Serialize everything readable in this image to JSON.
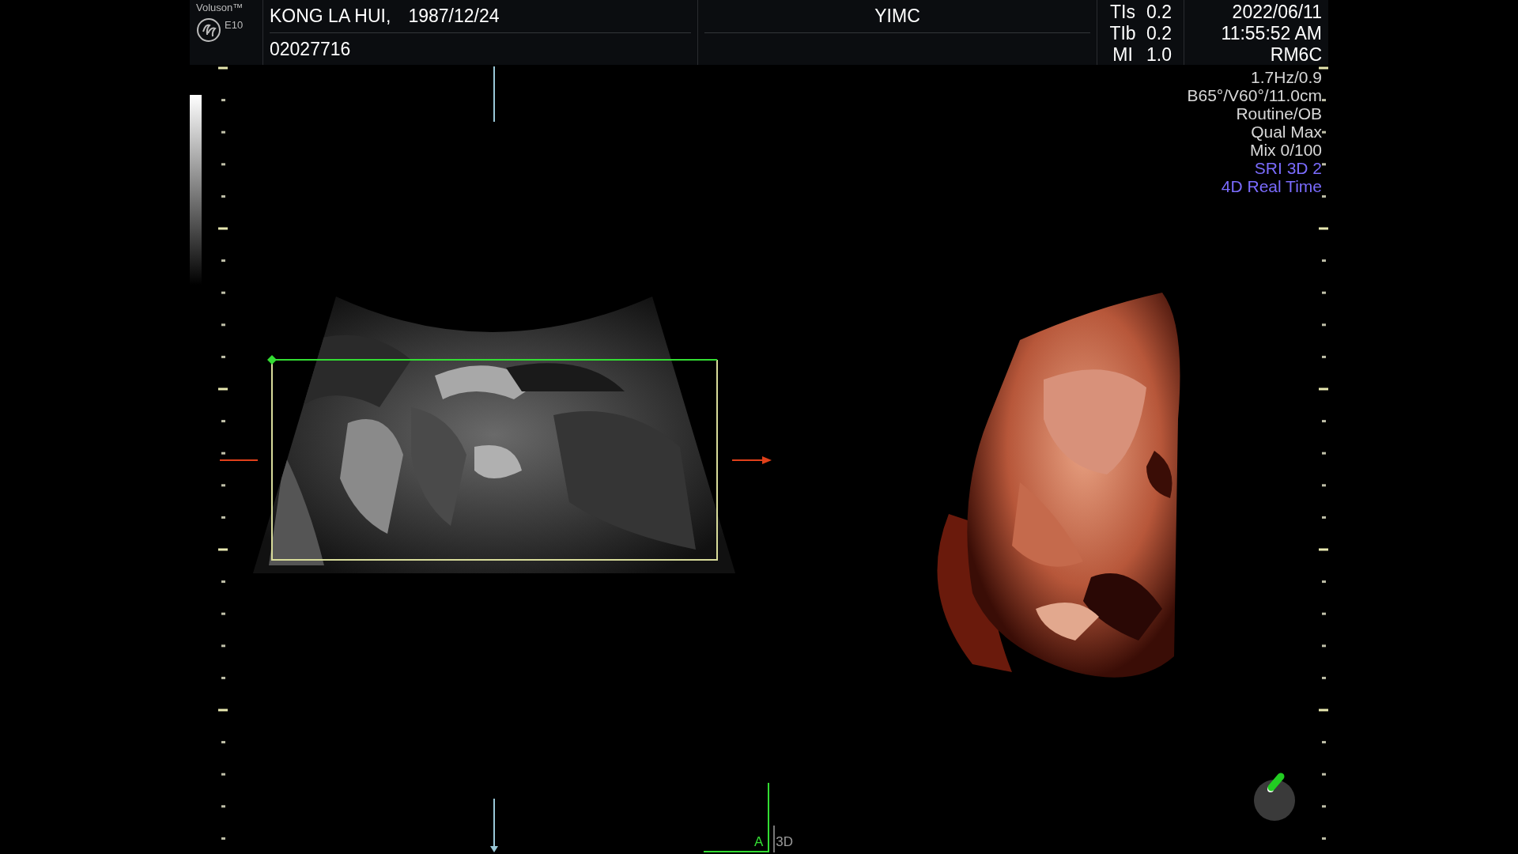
{
  "brand": {
    "name": "Voluson™",
    "model": "E10"
  },
  "patient": {
    "name": "KONG LA HUI,",
    "birth_date": "1987/12/24",
    "id": "02027716"
  },
  "institution": "YIMC",
  "indices": [
    {
      "label": "TIs",
      "value": "0.2"
    },
    {
      "label": "TIb",
      "value": "0.2"
    },
    {
      "label": "MI",
      "value": "1.0"
    }
  ],
  "datetime": {
    "date": "2022/06/11",
    "time": "11:55:52 AM"
  },
  "probe": "RM6C",
  "parameters": [
    {
      "text": "1.7Hz/0.9",
      "kind": "normal"
    },
    {
      "text": "B65°/V60°/11.0cm",
      "kind": "normal"
    },
    {
      "text": "Routine/OB",
      "kind": "normal"
    },
    {
      "text": "Qual Max",
      "kind": "normal"
    },
    {
      "text": "Mix 0/100",
      "kind": "normal"
    },
    {
      "text": "SRI 3D 2",
      "kind": "highlight"
    },
    {
      "text": "4D Real Time",
      "kind": "highlight"
    }
  ],
  "view_labels": [
    {
      "text": "A",
      "kind": "active"
    },
    {
      "text": "3D",
      "kind": "normal"
    }
  ]
}
